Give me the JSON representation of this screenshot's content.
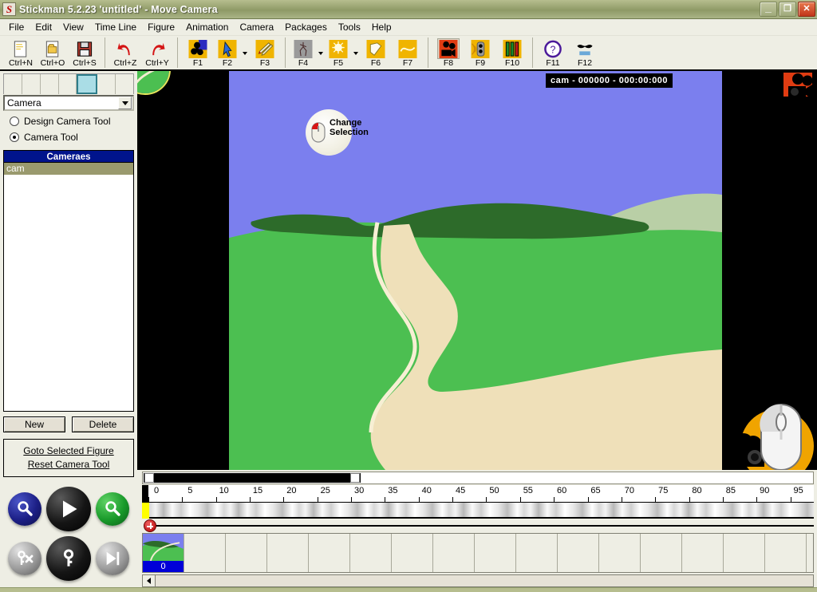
{
  "window": {
    "app_icon": "stickman-icon",
    "title": "Stickman 5.2.23  'untitled' - Move Camera",
    "minimize_label": "–",
    "restore_label": "❐",
    "close_label": "✕"
  },
  "menu": {
    "items": [
      {
        "label": "File",
        "accel": "F"
      },
      {
        "label": "Edit",
        "accel": "E"
      },
      {
        "label": "View",
        "accel": "V"
      },
      {
        "label": "Time Line",
        "accel": "L"
      },
      {
        "label": "Figure",
        "accel": "F"
      },
      {
        "label": "Animation",
        "accel": "A"
      },
      {
        "label": "Camera",
        "accel": "C"
      },
      {
        "label": "Packages",
        "accel": "P"
      },
      {
        "label": "Tools",
        "accel": "T"
      },
      {
        "label": "Help",
        "accel": "H"
      }
    ]
  },
  "toolbar": {
    "buttons": [
      {
        "label": "Ctrl+N",
        "icon": "new-document-icon",
        "dropdown": false,
        "selected": false
      },
      {
        "label": "Ctrl+O",
        "icon": "open-folder-icon",
        "dropdown": false,
        "selected": false
      },
      {
        "label": "Ctrl+S",
        "icon": "save-floppy-icon",
        "dropdown": false,
        "selected": false
      },
      {
        "label": "Ctrl+Z",
        "icon": "undo-arrow-icon",
        "dropdown": false,
        "selected": false
      },
      {
        "label": "Ctrl+Y",
        "icon": "redo-arrow-icon",
        "dropdown": false,
        "selected": false
      },
      {
        "label": "F1",
        "icon": "figure-icon",
        "dropdown": false,
        "selected": false
      },
      {
        "label": "F2",
        "icon": "select-pointer-icon",
        "dropdown": true,
        "selected": false
      },
      {
        "label": "F3",
        "icon": "pencil-draw-icon",
        "dropdown": false,
        "selected": false
      },
      {
        "label": "F4",
        "icon": "skeleton-icon",
        "dropdown": true,
        "selected": false
      },
      {
        "label": "F5",
        "icon": "light-icon",
        "dropdown": true,
        "selected": false
      },
      {
        "label": "F6",
        "icon": "page-icon",
        "dropdown": false,
        "selected": false
      },
      {
        "label": "F7",
        "icon": "curve-icon",
        "dropdown": false,
        "selected": false
      },
      {
        "label": "F8",
        "icon": "camera-icon",
        "dropdown": false,
        "selected": true
      },
      {
        "label": "F9",
        "icon": "traffic-light-icon",
        "dropdown": false,
        "selected": false
      },
      {
        "label": "F10",
        "icon": "mixer-icon",
        "dropdown": false,
        "selected": false
      },
      {
        "label": "F11",
        "icon": "help-question-icon",
        "dropdown": false,
        "selected": false
      },
      {
        "label": "F12",
        "icon": "moustache-icon",
        "dropdown": false,
        "selected": false
      }
    ]
  },
  "sidebar": {
    "tabs": [
      {
        "name": "tab-1",
        "active": false
      },
      {
        "name": "tab-2",
        "active": false
      },
      {
        "name": "tab-3",
        "active": false
      },
      {
        "name": "tab-4",
        "active": false
      },
      {
        "name": "tab-5",
        "active": true
      },
      {
        "name": "tab-6",
        "active": false
      },
      {
        "name": "tab-7",
        "active": false
      }
    ],
    "combo": {
      "value": "Camera",
      "options": [
        "Camera"
      ]
    },
    "radios": [
      {
        "label": "Design Camera Tool",
        "selected": false
      },
      {
        "label": "Camera Tool",
        "selected": true
      }
    ],
    "list": {
      "header": "Cameraes",
      "items": [
        {
          "label": "cam",
          "selected": true
        }
      ]
    },
    "buttons": {
      "new_label": "New",
      "delete_label": "Delete"
    },
    "links": [
      {
        "label": "Goto Selected Figure"
      },
      {
        "label": "Reset Camera Tool"
      }
    ],
    "circle_buttons": [
      {
        "name": "zoom-out-button",
        "icon": "magnifier-blue-icon",
        "color": "#1c1f86"
      },
      {
        "name": "play-button",
        "icon": "play-icon",
        "color": "#000000"
      },
      {
        "name": "zoom-in-button",
        "icon": "magnifier-green-icon",
        "color": "#199a2a"
      },
      {
        "name": "delete-key-button",
        "icon": "key-delete-icon",
        "color": "#9b9b9b"
      },
      {
        "name": "add-key-button",
        "icon": "key-icon",
        "color": "#000000"
      },
      {
        "name": "step-forward-button",
        "icon": "step-forward-icon",
        "color": "#9b9b9b"
      }
    ]
  },
  "stage": {
    "camera_label": "cam - 000000 - 000:00:000",
    "change_selection_label_line1": "Change",
    "change_selection_label_line2": "Selection",
    "cursor_icon": "mouse-cursor-icon",
    "camera_badge_icon": "camera-badge-icon",
    "scene_colors": {
      "sky": "#7b7fee",
      "distant_hill": "#b9cfa6",
      "grass": "#4cbf51",
      "forest": "#2d6b2a",
      "path": "#efe0b9",
      "letterbox": "#000000"
    }
  },
  "timeline": {
    "scroll_thumb_start": 0,
    "scroll_thumb_end": 32,
    "ruler": {
      "ticks": [
        0,
        5,
        10,
        15,
        20,
        25,
        30,
        35,
        40,
        45,
        50,
        55,
        60,
        65,
        70,
        75,
        80,
        85,
        90,
        95
      ],
      "min": 0,
      "max": 98,
      "playhead": 0
    },
    "marker_color": "#ffff00",
    "add_button": "add-track-button",
    "frames": [
      {
        "index": "0",
        "filled": true
      },
      {
        "index": "",
        "filled": false
      },
      {
        "index": "",
        "filled": false
      },
      {
        "index": "",
        "filled": false
      },
      {
        "index": "",
        "filled": false
      },
      {
        "index": "",
        "filled": false
      },
      {
        "index": "",
        "filled": false
      },
      {
        "index": "",
        "filled": false
      },
      {
        "index": "",
        "filled": false
      },
      {
        "index": "",
        "filled": false
      },
      {
        "index": "",
        "filled": false
      },
      {
        "index": "",
        "filled": false
      },
      {
        "index": "",
        "filled": false
      },
      {
        "index": "",
        "filled": false
      },
      {
        "index": "",
        "filled": false
      },
      {
        "index": "",
        "filled": false
      }
    ],
    "scroll_left_arrow": "scroll-left-arrow-icon"
  }
}
